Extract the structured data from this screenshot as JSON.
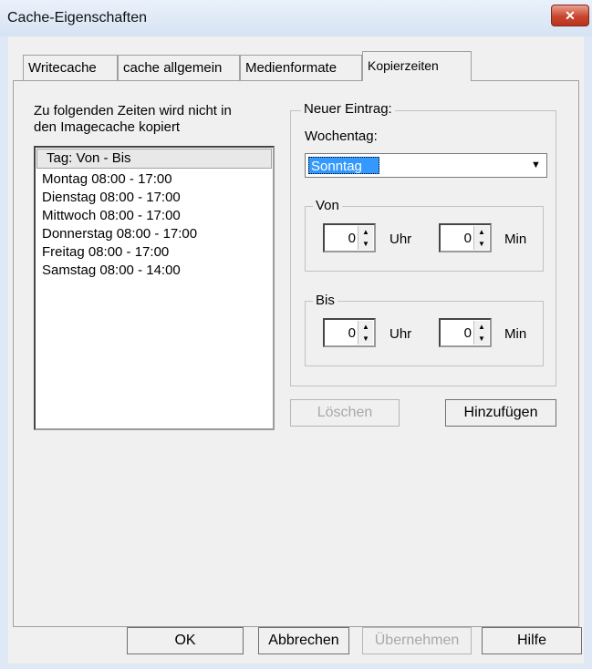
{
  "window": {
    "title": "Cache-Eigenschaften",
    "close_glyph": "✕"
  },
  "tabs": [
    {
      "label": "Writecache"
    },
    {
      "label": "cache allgemein"
    },
    {
      "label": "Medienformate"
    },
    {
      "label": "Kopierzeiten",
      "active": true
    }
  ],
  "left": {
    "description": [
      "Zu folgenden Zeiten wird nicht in",
      "den Imagecache kopiert"
    ],
    "list_header": "Tag: Von - Bis",
    "entries": [
      "Montag 08:00 - 17:00",
      "Dienstag 08:00 - 17:00",
      "Mittwoch 08:00 - 17:00",
      "Donnerstag 08:00 - 17:00",
      "Freitag 08:00 - 17:00",
      "Samstag 08:00 - 14:00"
    ]
  },
  "new_entry": {
    "group_label": "Neuer Eintrag:",
    "weekday_label": "Wochentag:",
    "weekday_value": "Sonntag",
    "from": {
      "label": "Von",
      "hour": "0",
      "hour_unit": "Uhr",
      "minute": "0",
      "minute_unit": "Min"
    },
    "to": {
      "label": "Bis",
      "hour": "0",
      "hour_unit": "Uhr",
      "minute": "0",
      "minute_unit": "Min"
    }
  },
  "actions": {
    "delete": "Löschen",
    "add": "Hinzufügen"
  },
  "footer": {
    "ok": "OK",
    "cancel": "Abbrechen",
    "apply": "Übernehmen",
    "help": "Hilfe"
  }
}
